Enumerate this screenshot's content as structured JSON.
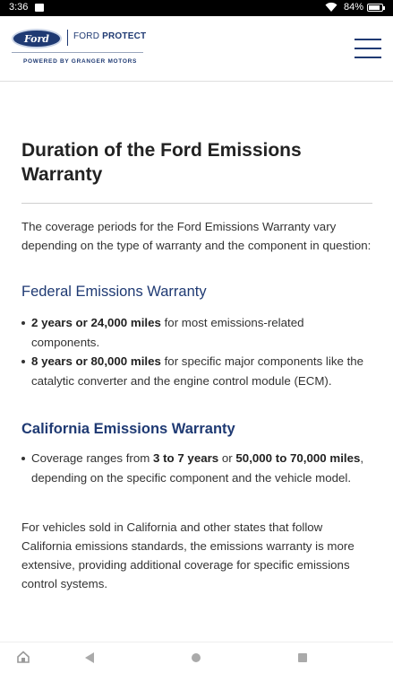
{
  "status_bar": {
    "time": "3:36",
    "battery_percent": "84%",
    "battery_level": 0.84
  },
  "header": {
    "logo_text": "Ford",
    "brand_prefix": "FORD",
    "brand_suffix": "PROTECT",
    "powered_by": "POWERED BY GRANGER MOTORS"
  },
  "article": {
    "title": "Duration of the Ford Emissions Warranty",
    "intro": "The coverage periods for the Ford Emissions Warranty vary depending on the type of warranty and the component in question:",
    "federal": {
      "heading": "Federal Emissions Warranty",
      "items": [
        {
          "bold": "2 years or 24,000 miles",
          "text": " for most emissions-related components."
        },
        {
          "bold": "8 years or 80,000 miles",
          "text": " for specific major components like the catalytic converter and the engine control module (ECM)."
        }
      ]
    },
    "california": {
      "heading": "California Emissions Warranty",
      "item": {
        "pre": "Coverage ranges from ",
        "bold1": "3 to 7 years",
        "mid": " or ",
        "bold2": "50,000 to 70,000 miles",
        "post": ", depending on the specific component and the vehicle model."
      }
    },
    "closing": "For vehicles sold in California and other states that follow California emissions standards, the emissions warranty is more extensive, providing additional coverage for specific emissions control systems."
  }
}
